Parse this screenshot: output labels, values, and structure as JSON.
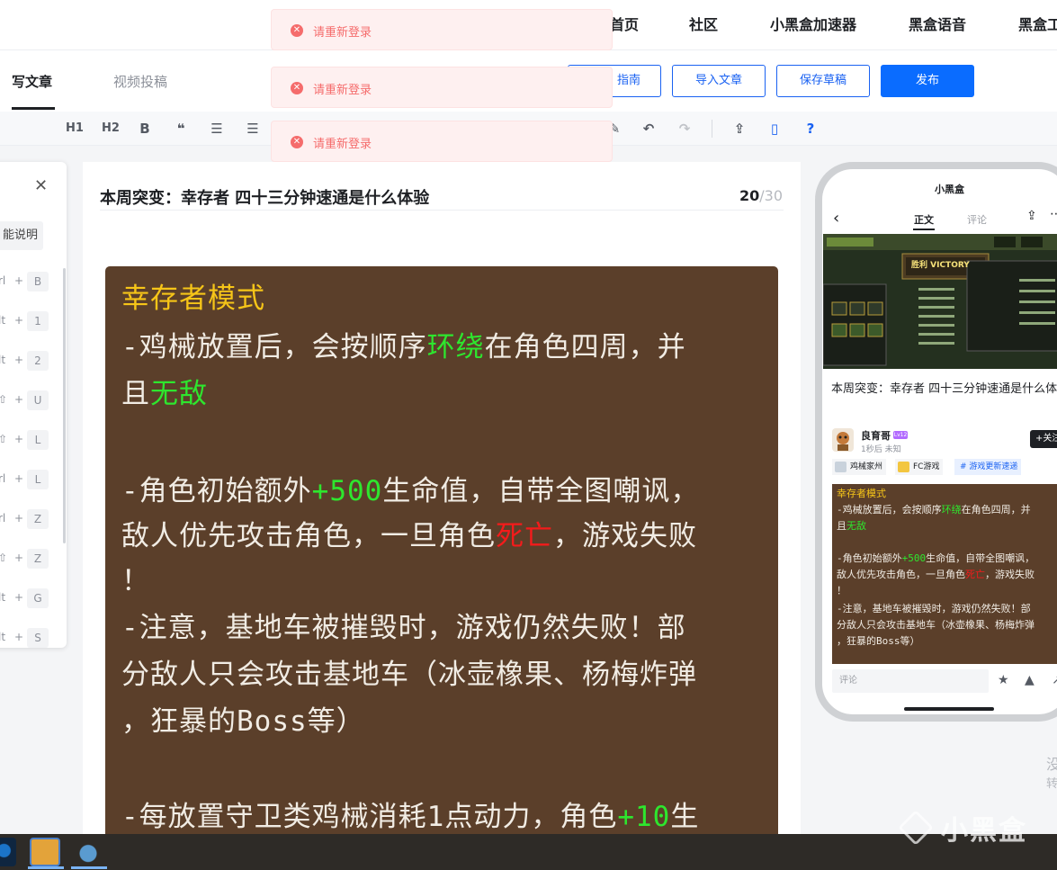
{
  "nav": {
    "items": [
      "首页",
      "社区",
      "小黑盒加速器",
      "黑盒语音",
      "黑盒工"
    ]
  },
  "tabs": {
    "write": "写文章",
    "video": "视频投稿"
  },
  "buttons": {
    "guide": "指南",
    "import": "导入文章",
    "save_draft": "保存草稿",
    "publish": "发布"
  },
  "toolbar": {
    "h1": "H1",
    "h2": "H2",
    "bold": "B",
    "quote": "❝",
    "ol": "☰",
    "ul": "☰",
    "undo": "↶",
    "redo": "↷",
    "upload": "⇪",
    "mobile": "▯",
    "help": "?",
    "pen": "✎"
  },
  "shortcuts": {
    "chip": "能说明",
    "rows": [
      {
        "mod": "rl",
        "key": "B"
      },
      {
        "mod": "lt",
        "key": "1"
      },
      {
        "mod": "lt",
        "key": "2"
      },
      {
        "mod": "⇧",
        "key": "U"
      },
      {
        "mod": "⇧",
        "key": "L"
      },
      {
        "mod": "rl",
        "key": "L"
      },
      {
        "mod": "rl",
        "key": "Z"
      },
      {
        "mod": "⇧",
        "key": "Z"
      },
      {
        "mod": "lt",
        "key": "G"
      },
      {
        "mod": "lt",
        "key": "S"
      }
    ]
  },
  "editor": {
    "title": "本周突变：幸存者 四十三分钟速通是什么体验",
    "count": "20",
    "max": "/30",
    "image_lines": [
      [
        {
          "t": "幸存者模式",
          "c": "head"
        }
      ],
      [
        {
          "t": "-鸡械放置后，会按顺序",
          "c": ""
        },
        {
          "t": "环绕",
          "c": "g"
        },
        {
          "t": "在角色四周，并",
          "c": ""
        }
      ],
      [
        {
          "t": "且",
          "c": ""
        },
        {
          "t": "无敌",
          "c": "g"
        }
      ],
      [
        {
          "t": "-角色初始额外",
          "c": ""
        },
        {
          "t": "+500",
          "c": "g"
        },
        {
          "t": "生命值，自带全图嘲讽，",
          "c": ""
        }
      ],
      [
        {
          "t": "敌人优先攻击角色，一旦角色",
          "c": ""
        },
        {
          "t": "死亡",
          "c": "r"
        },
        {
          "t": "，游戏失败",
          "c": ""
        }
      ],
      [
        {
          "t": "！",
          "c": ""
        }
      ],
      [
        {
          "t": "-注意，基地车被摧毁时，游戏仍然失败！部",
          "c": ""
        }
      ],
      [
        {
          "t": "分敌人只会攻击基地车（冰壶橡果、杨梅炸弹",
          "c": ""
        }
      ],
      [
        {
          "t": "，狂暴的Boss等）",
          "c": ""
        }
      ],
      [
        {
          "t": "-每放置守卫类鸡械消耗1点动力，角色",
          "c": ""
        },
        {
          "t": "+10",
          "c": "g"
        },
        {
          "t": "生",
          "c": ""
        }
      ]
    ]
  },
  "phone": {
    "logo": "小黑盒",
    "tab_text": "正文",
    "tab_comment": "评论",
    "title": "本周突变：幸存者 四十三分钟速通是什么体验",
    "author": "良育哥",
    "level": "Lv12",
    "time": "1秒后 未知",
    "follow": "+关注",
    "tags": [
      "鸡械家州",
      "FC游戏",
      "# 游戏更新速递"
    ],
    "victory": "胜利 VICTORY",
    "comment_placeholder": "评论",
    "image_lines": [
      [
        {
          "t": "幸存者模式",
          "c": "head"
        }
      ],
      [
        {
          "t": "-鸡械放置后，会按顺序",
          "c": ""
        },
        {
          "t": "环绕",
          "c": "g"
        },
        {
          "t": "在角色四周，并",
          "c": ""
        }
      ],
      [
        {
          "t": "且",
          "c": ""
        },
        {
          "t": "无敌",
          "c": "g"
        }
      ],
      [
        {
          "t": "-角色初始额外",
          "c": ""
        },
        {
          "t": "+500",
          "c": "g"
        },
        {
          "t": "生命值，自带全图嘲讽，",
          "c": ""
        }
      ],
      [
        {
          "t": "敌人优先攻击角色，一旦角色",
          "c": ""
        },
        {
          "t": "死亡",
          "c": "r"
        },
        {
          "t": "，游戏失败",
          "c": ""
        }
      ],
      [
        {
          "t": "！",
          "c": ""
        }
      ],
      [
        {
          "t": "-注意，基地车被摧毁时，游戏仍然失败！部",
          "c": ""
        }
      ],
      [
        {
          "t": "分敌人只会攻击基地车（冰壶橡果、杨梅炸弹",
          "c": ""
        }
      ],
      [
        {
          "t": "，狂暴的Boss等）",
          "c": ""
        }
      ]
    ]
  },
  "side_fragments": [
    "没",
    "转"
  ],
  "toasts": [
    "请重新登录",
    "请重新登录",
    "请重新登录"
  ],
  "watermark": "小黑盒",
  "colors": {
    "accent": "#0a6cff",
    "toast_text": "#f56c6c",
    "game_bg": "#5b3f2a",
    "green": "#2ee62e",
    "red": "#f41b1b",
    "gold": "#f6c518"
  }
}
